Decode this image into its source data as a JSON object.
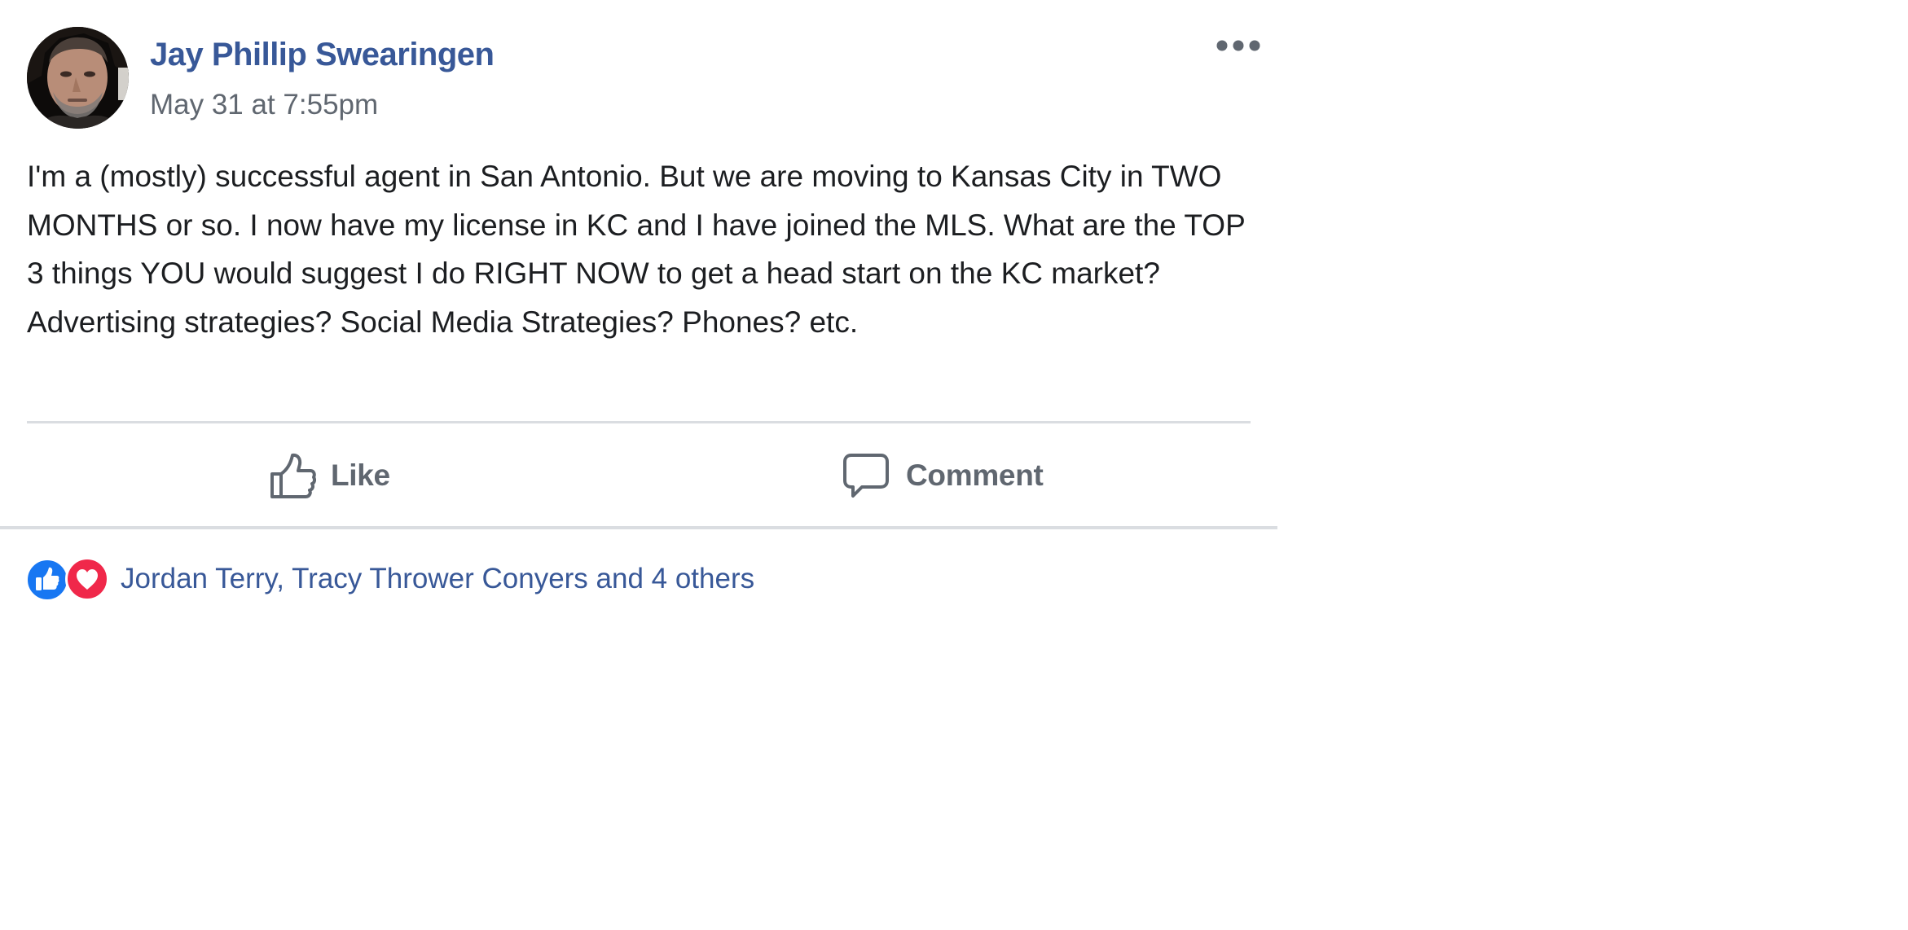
{
  "post": {
    "author": "Jay Phillip Swearingen",
    "timestamp": "May 31 at 7:55pm",
    "text": "I'm a (mostly) successful agent in San Antonio. But we are moving to Kansas City in TWO MONTHS or so. I now have my license in KC and I have joined the MLS. What are the TOP 3 things YOU would suggest I do RIGHT NOW to get a head start on the KC market? Advertising strategies? Social Media Strategies? Phones? etc."
  },
  "actions": {
    "like_label": "Like",
    "comment_label": "Comment"
  },
  "reactions": {
    "types": [
      "like",
      "love"
    ],
    "summary": "Jordan Terry, Tracy Thrower Conyers and 4 others"
  },
  "icons": {
    "more": "more-options-icon",
    "like": "thumbs-up-icon",
    "comment": "comment-bubble-icon",
    "reaction_like": "like-reaction-icon",
    "reaction_love": "love-reaction-icon"
  },
  "colors": {
    "link": "#385898",
    "secondary_text": "#606770",
    "body_text": "#1c1e21",
    "divider": "#dadde1",
    "like_blue": "#1877f2",
    "love_red": "#f0284a"
  }
}
